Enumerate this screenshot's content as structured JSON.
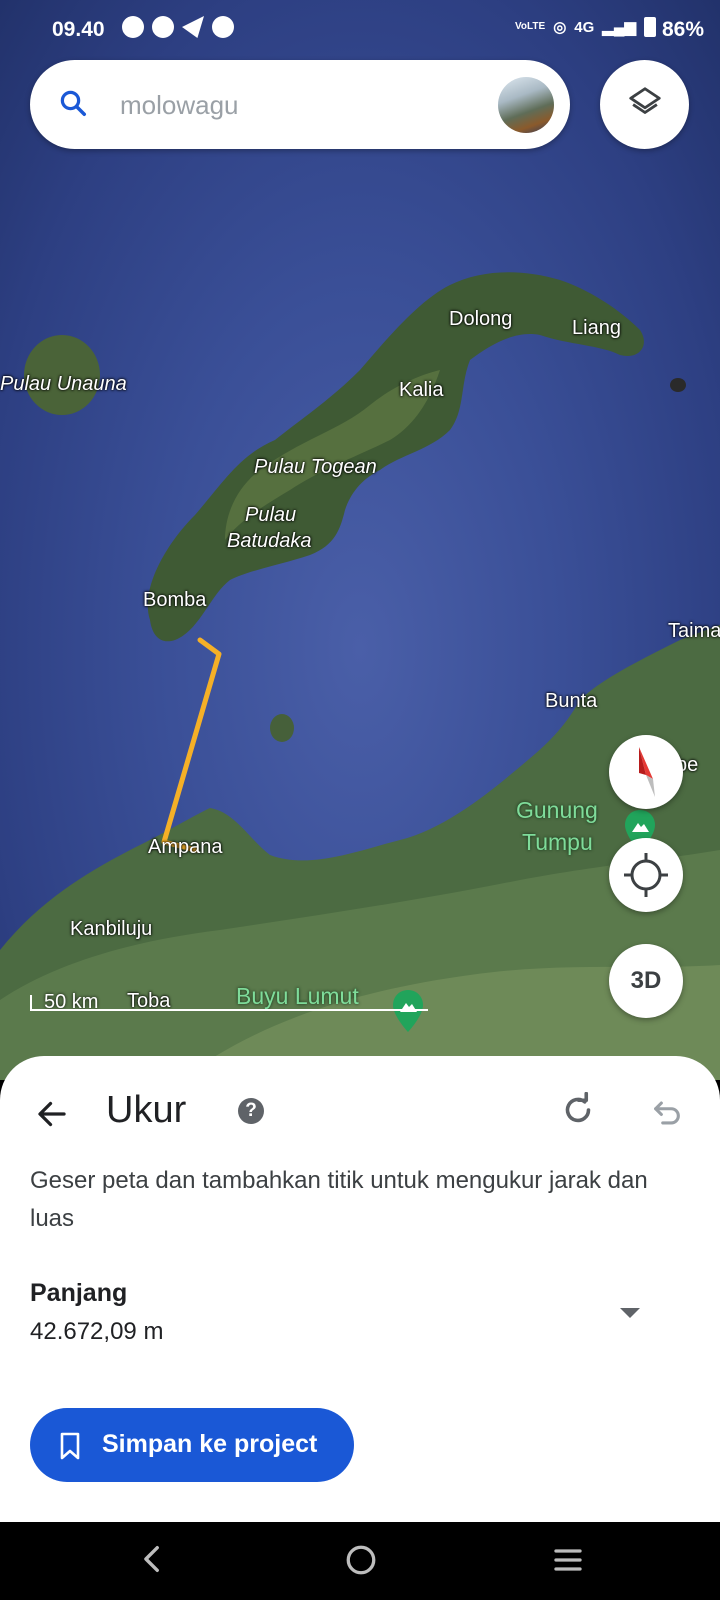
{
  "status_bar": {
    "time": "09.40",
    "network": "4G",
    "battery": "86%"
  },
  "search": {
    "placeholder": "molowagu"
  },
  "map": {
    "labels": [
      {
        "text": "Dolong"
      },
      {
        "text": "Liang"
      },
      {
        "text": "Pulau Unauna"
      },
      {
        "text": "Kalia"
      },
      {
        "text": "Pulau Togean"
      },
      {
        "text": "Pulau"
      },
      {
        "text": "Batudaka"
      },
      {
        "text": "Bomba"
      },
      {
        "text": "Taima"
      },
      {
        "text": "Bunta"
      },
      {
        "text": "be"
      },
      {
        "text": "Ampana"
      },
      {
        "text": "Kanbiluju"
      },
      {
        "text": "Toba"
      }
    ],
    "poi_labels": [
      {
        "text": "Gunung"
      },
      {
        "text": "Tumpu"
      },
      {
        "text": "Buyu Lumut"
      }
    ],
    "scale_label": "50 km",
    "three_d_label": "3D",
    "measure_line_color": "#f5b027"
  },
  "panel": {
    "title": "Ukur",
    "help_glyph": "?",
    "instruction": "Geser peta dan tambahkan titik untuk mengukur jarak dan luas",
    "length_label": "Panjang",
    "length_value": "42.672,09 m",
    "save_button": "Simpan ke project"
  },
  "colors": {
    "accent": "#1a58d6",
    "sheet_bg": "#ffffff"
  }
}
